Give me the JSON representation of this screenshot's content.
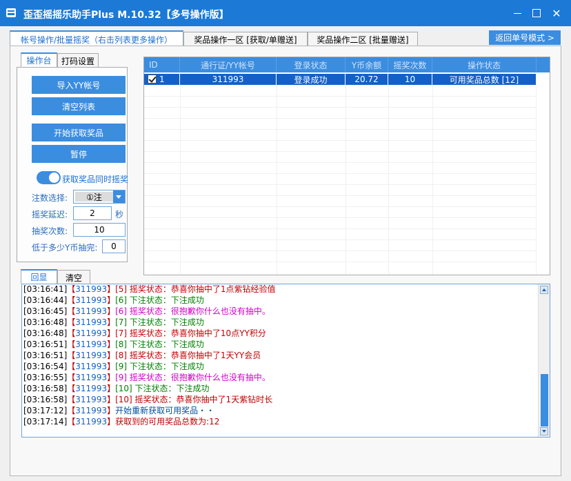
{
  "title": "歪歪摇摇乐助手Plus M.10.32【多号操作版】",
  "main_tabs": [
    "帐号操作/批量摇奖（右击列表更多操作）",
    "奖品操作一区 [获取/单赠送]",
    "奖品操作二区 [批量赠送]"
  ],
  "back_button": "返回单号模式 >",
  "sub_tabs": [
    "操作台",
    "打码设置"
  ],
  "buttons": {
    "import": "导入YY帐号",
    "clear_list": "清空列表",
    "start": "开始获取奖品",
    "pause": "暂停"
  },
  "toggle": {
    "label": "获取奖品同时摇奖",
    "on": true
  },
  "fields": {
    "bet_label": "注数选择:",
    "bet_value": "①注",
    "delay_label": "摇奖延迟:",
    "delay_value": "2",
    "delay_unit": "秒",
    "count_label": "抽奖次数:",
    "count_value": "10",
    "min_label": "低于多少Y币抽完:",
    "min_value": "0"
  },
  "grid": {
    "columns": [
      "ID",
      "通行证/YY帐号",
      "登录状态",
      "Y币余额",
      "摇奖次数",
      "操作状态"
    ],
    "rows": [
      {
        "id": "1",
        "account": "311993",
        "login": "登录成功",
        "balance": "20.72",
        "count": "10",
        "status": "可用奖品总数 [12]",
        "checked": true
      }
    ]
  },
  "log_tabs": [
    "回显",
    "清空"
  ],
  "log": [
    {
      "time": "[03:16:41]",
      "acct": "【311993】",
      "msg": "[5] 摇奖状态：恭喜你抽中了1点紫钻经验值",
      "color": "red"
    },
    {
      "time": "[03:16:44]",
      "acct": "【311993】",
      "msg": "[6] 下注状态：下注成功",
      "color": "green"
    },
    {
      "time": "[03:16:45]",
      "acct": "【311993】",
      "msg": "[6] 摇奖状态：很抱歉你什么也没有抽中。",
      "color": "mag"
    },
    {
      "time": "[03:16:48]",
      "acct": "【311993】",
      "msg": "[7] 下注状态：下注成功",
      "color": "green"
    },
    {
      "time": "[03:16:48]",
      "acct": "【311993】",
      "msg": "[7] 摇奖状态：恭喜你抽中了10点YY积分",
      "color": "red"
    },
    {
      "time": "[03:16:51]",
      "acct": "【311993】",
      "msg": "[8] 下注状态：下注成功",
      "color": "green"
    },
    {
      "time": "[03:16:51]",
      "acct": "【311993】",
      "msg": "[8] 摇奖状态：恭喜你抽中了1天YY会员",
      "color": "red"
    },
    {
      "time": "[03:16:54]",
      "acct": "【311993】",
      "msg": "[9] 下注状态：下注成功",
      "color": "green"
    },
    {
      "time": "[03:16:55]",
      "acct": "【311993】",
      "msg": "[9] 摇奖状态：很抱歉你什么也没有抽中。",
      "color": "mag"
    },
    {
      "time": "[03:16:58]",
      "acct": "【311993】",
      "msg": "[10] 下注状态：下注成功",
      "color": "green"
    },
    {
      "time": "[03:16:58]",
      "acct": "【311993】",
      "msg": "[10] 摇奖状态：恭喜你抽中了1天紫钻时长",
      "color": "red"
    },
    {
      "time": "[03:17:12]",
      "acct": "【311993】",
      "msg": "开始重新获取可用奖品・・",
      "color": "navy"
    },
    {
      "time": "[03:17:14]",
      "acct": "【311993】",
      "msg": "获取到的可用奖品总数为:12",
      "color": "red"
    }
  ],
  "colors": {
    "accent": "#3b8de0",
    "titlebar": "#1c79d6",
    "selected_row": "#1560c8"
  },
  "icons": [
    "app-icon",
    "minimize-icon",
    "maximize-icon",
    "close-icon",
    "checkbox-icon",
    "chevron-down-icon"
  ]
}
